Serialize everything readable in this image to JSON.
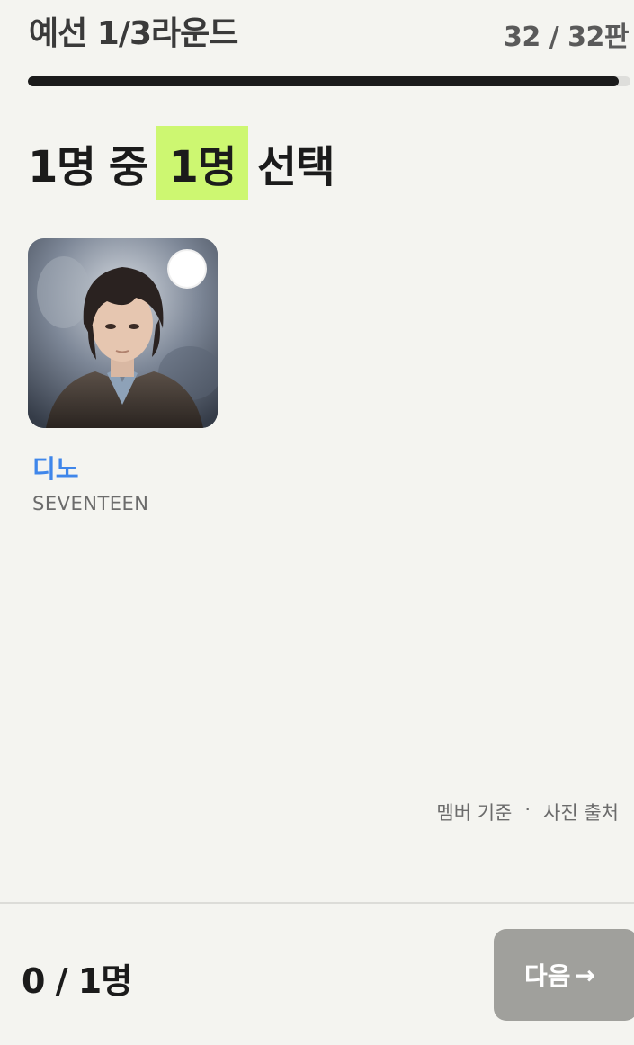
{
  "header": {
    "round_title": "예선 1/3라운드",
    "game_count": "32 / 32판",
    "progress_fraction": 0.98
  },
  "prompt": {
    "prefix": "1명 중",
    "highlight": "1명",
    "suffix": "선택"
  },
  "candidates": [
    {
      "name": "디노",
      "group": "SEVENTEEN",
      "selected": false
    }
  ],
  "footnote": {
    "member_basis": "멤버 기준",
    "separator": "·",
    "photo_source": "사진 출처"
  },
  "bottom_bar": {
    "selection_count": "0 / 1명",
    "next_label": "다음",
    "next_arrow": "→"
  },
  "colors": {
    "background": "#f4f4f0",
    "highlight": "#cdf771",
    "name_accent": "#3f86ea",
    "button_disabled": "#a0a09c"
  },
  "icons": {
    "select": "circle-checkbox-icon",
    "next": "arrow-right-icon"
  }
}
